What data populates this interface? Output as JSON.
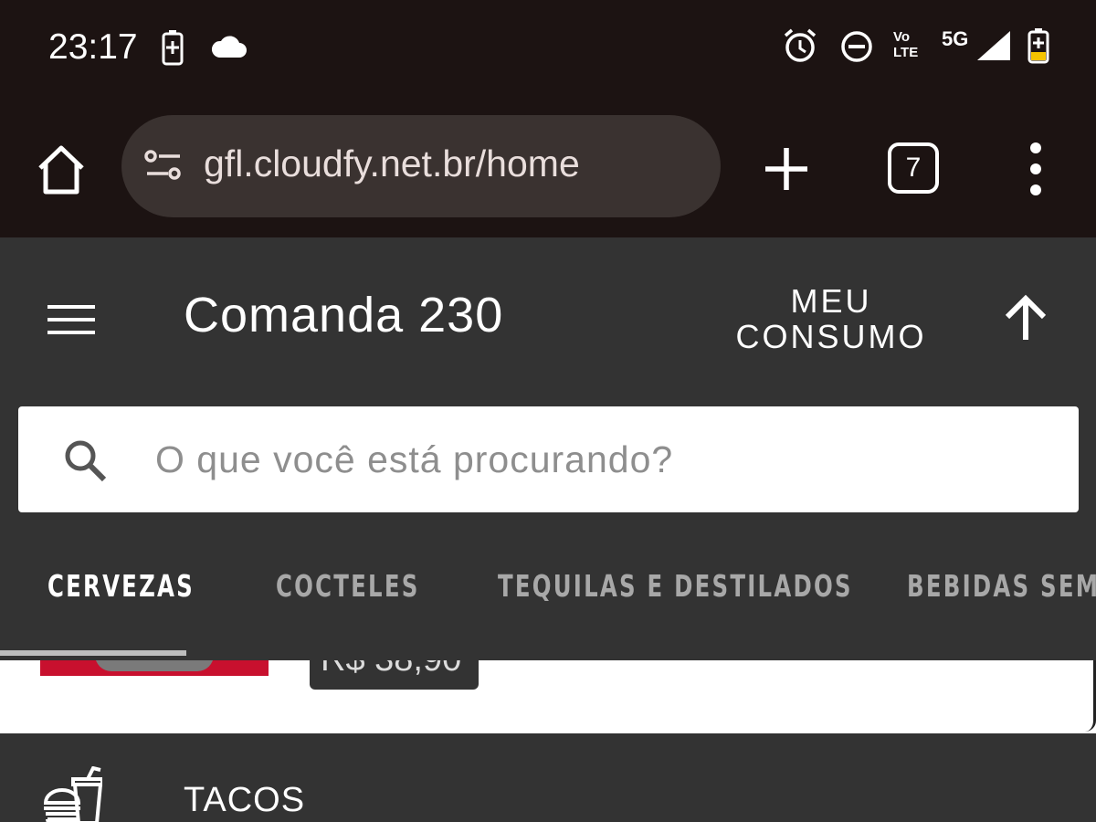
{
  "status_bar": {
    "time": "23:17",
    "network": "5G",
    "volte": "Vo LTE"
  },
  "browser": {
    "url": "gfl.cloudfy.net.br/home",
    "tab_count": "7"
  },
  "header": {
    "title": "Comanda 230",
    "consumo_label": "MEU CONSUMO"
  },
  "search": {
    "placeholder": "O que você está procurando?"
  },
  "categories": [
    "CERVEZAS",
    "COCTELES",
    "TEQUILAS E DESTILADOS",
    "BEBIDAS SEM"
  ],
  "active_category_index": 0,
  "product": {
    "price": "R$ 38,90"
  },
  "bottom_section": {
    "label": "TACOS"
  },
  "colors": {
    "status_bar_bg": "#1c1312",
    "header_bg": "#333333",
    "url_box_bg": "#3a3230",
    "product_accent": "#c8102e"
  },
  "icons": {
    "status": [
      "battery-charging-icon",
      "cloud-icon",
      "alarm-icon",
      "do-not-disturb-icon",
      "volte-icon",
      "signal-icon",
      "battery-icon"
    ],
    "browser": [
      "home-icon",
      "site-settings-icon",
      "plus-icon",
      "tab-switcher-icon",
      "more-vert-icon"
    ],
    "app": [
      "hamburger-icon",
      "arrow-up-icon",
      "search-icon",
      "burger-drink-icon"
    ]
  }
}
